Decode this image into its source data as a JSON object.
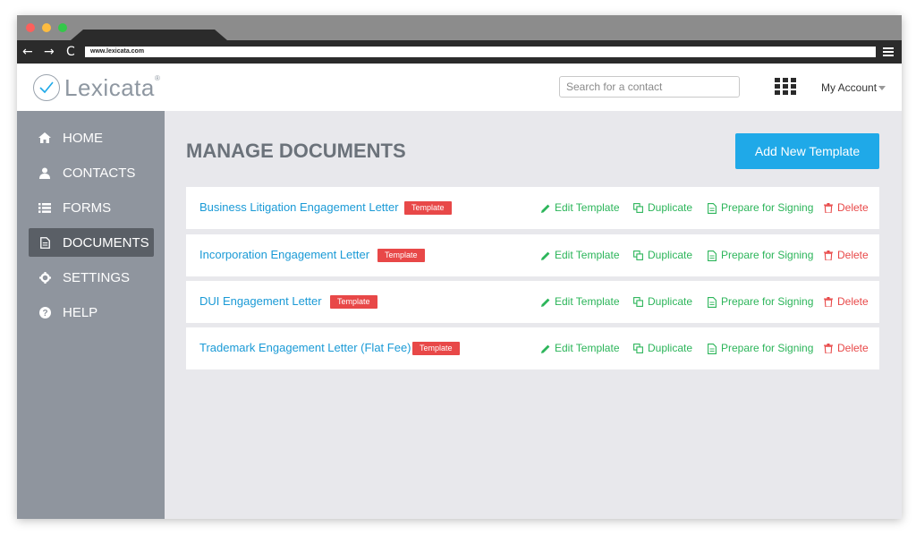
{
  "browser": {
    "url": "www.lexicata.com"
  },
  "header": {
    "logo_text": "Lexicata",
    "logo_reg": "®",
    "search_placeholder": "Search for a contact",
    "account_label": "My Account"
  },
  "sidebar": {
    "items": [
      {
        "label": "HOME",
        "icon": "home-icon"
      },
      {
        "label": "CONTACTS",
        "icon": "user-icon"
      },
      {
        "label": "FORMS",
        "icon": "list-icon"
      },
      {
        "label": "DOCUMENTS",
        "icon": "document-icon",
        "active": true
      },
      {
        "label": "SETTINGS",
        "icon": "gear-icon"
      },
      {
        "label": "HELP",
        "icon": "question-icon"
      }
    ]
  },
  "main": {
    "title": "MANAGE DOCUMENTS",
    "add_button": "Add New Template",
    "actions": {
      "edit": "Edit Template",
      "duplicate": "Duplicate",
      "sign": "Prepare for Signing",
      "delete": "Delete"
    },
    "documents": [
      {
        "name": "Business Litigation Engagement Letter",
        "badge": "Template"
      },
      {
        "name": "Incorporation Engagement Letter",
        "badge": "Template"
      },
      {
        "name": "DUI Engagement Letter",
        "badge": "Template"
      },
      {
        "name": "Trademark Engagement Letter (Flat Fee)",
        "badge": "Template"
      }
    ]
  },
  "colors": {
    "accent": "#1fa9e8",
    "link": "#1a9ad6",
    "action_green": "#2cb55a",
    "danger": "#e84848",
    "sidebar": "#8f959e",
    "sidebar_active": "#5a5f66"
  }
}
